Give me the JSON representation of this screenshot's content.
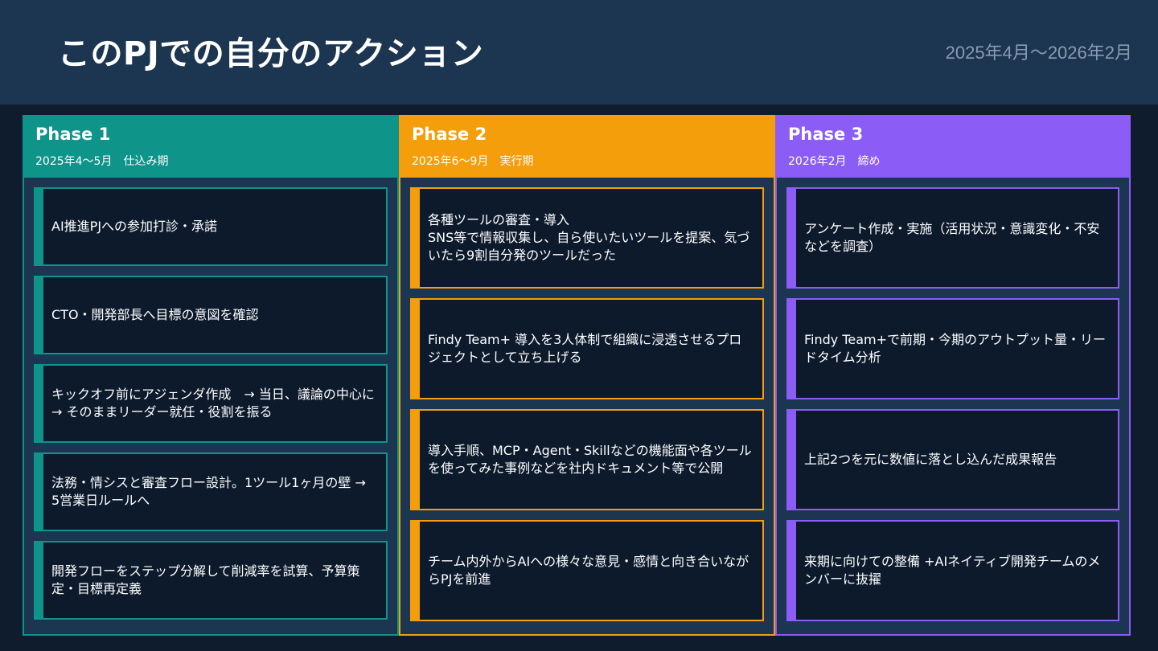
{
  "header": {
    "title": "このPJでの自分のアクション",
    "period": "2025年4月〜2026年2月"
  },
  "colors": {
    "phase1": "#0e9488",
    "phase2": "#f59e0b",
    "phase3": "#8b5cf6"
  },
  "phases": [
    {
      "name": "Phase 1",
      "subtitle": "2025年4〜5月　仕込み期",
      "items": [
        "AI推進PJへの参加打診・承諾",
        "CTO・開発部長へ目標の意図を確認",
        "キックオフ前にアジェンダ作成　→ 当日、議論の中心に → そのままリーダー就任・役割を振る",
        "法務・情シスと審査フロー設計。1ツール1ヶ月の壁 → 5営業日ルールへ",
        "開発フローをステップ分解して削減率を試算、予算策定・目標再定義"
      ]
    },
    {
      "name": "Phase 2",
      "subtitle": "2025年6〜9月　実行期",
      "items": [
        "各種ツールの審査・導入\nSNS等で情報収集し、自ら使いたいツールを提案、気づいたら9割自分発のツールだった",
        "Findy Team+ 導入を3人体制で組織に浸透させるプロジェクトとして立ち上げる",
        "導入手順、MCP・Agent・Skillなどの機能面や各ツールを使ってみた事例などを社内ドキュメント等で公開",
        "チーム内外からAIへの様々な意見・感情と向き合いながらPJを前進"
      ]
    },
    {
      "name": "Phase 3",
      "subtitle": "2026年2月　締め",
      "items": [
        "アンケート作成・実施（活用状況・意識変化・不安などを調査）",
        "Findy Team+で前期・今期のアウトプット量・リードタイム分析",
        "上記2つを元に数値に落とし込んだ成果報告",
        "来期に向けての整備 +AIネイティブ開発チームのメンバーに抜擢"
      ]
    }
  ]
}
